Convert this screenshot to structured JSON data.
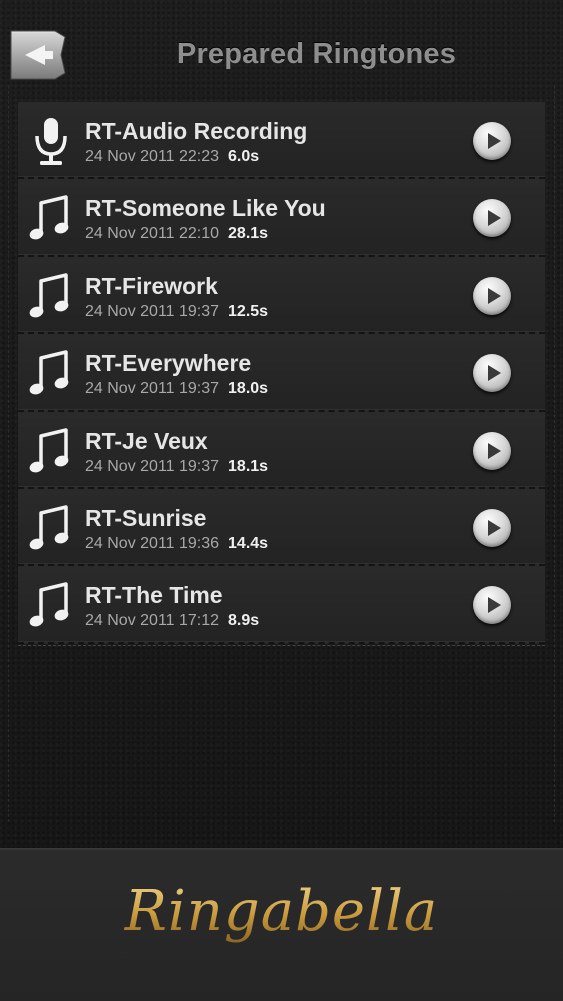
{
  "header": {
    "title": "Prepared Ringtones",
    "back_icon": "back-arrow-icon"
  },
  "ringtones": [
    {
      "title": "RT-Audio Recording",
      "date": "24 Nov 2011 22:23",
      "duration": "6.0s",
      "icon": "microphone-icon"
    },
    {
      "title": "RT-Someone Like You",
      "date": "24 Nov 2011 22:10",
      "duration": "28.1s",
      "icon": "music-note-icon"
    },
    {
      "title": "RT-Firework",
      "date": "24 Nov 2011 19:37",
      "duration": "12.5s",
      "icon": "music-note-icon"
    },
    {
      "title": "RT-Everywhere",
      "date": "24 Nov 2011 19:37",
      "duration": "18.0s",
      "icon": "music-note-icon"
    },
    {
      "title": "RT-Je Veux",
      "date": "24 Nov 2011 19:37",
      "duration": "18.1s",
      "icon": "music-note-icon"
    },
    {
      "title": "RT-Sunrise",
      "date": "24 Nov 2011 19:36",
      "duration": "14.4s",
      "icon": "music-note-icon"
    },
    {
      "title": "RT-The Time",
      "date": "24 Nov 2011 17:12",
      "duration": "8.9s",
      "icon": "music-note-icon"
    }
  ],
  "footer": {
    "brand": "Ringabella"
  },
  "colors": {
    "background": "#1c1c1c",
    "title_text": "#8e8e8e",
    "row_title": "#e6e6e6",
    "row_meta": "#a8a8a8",
    "brand_gold": "#c9a04a"
  }
}
